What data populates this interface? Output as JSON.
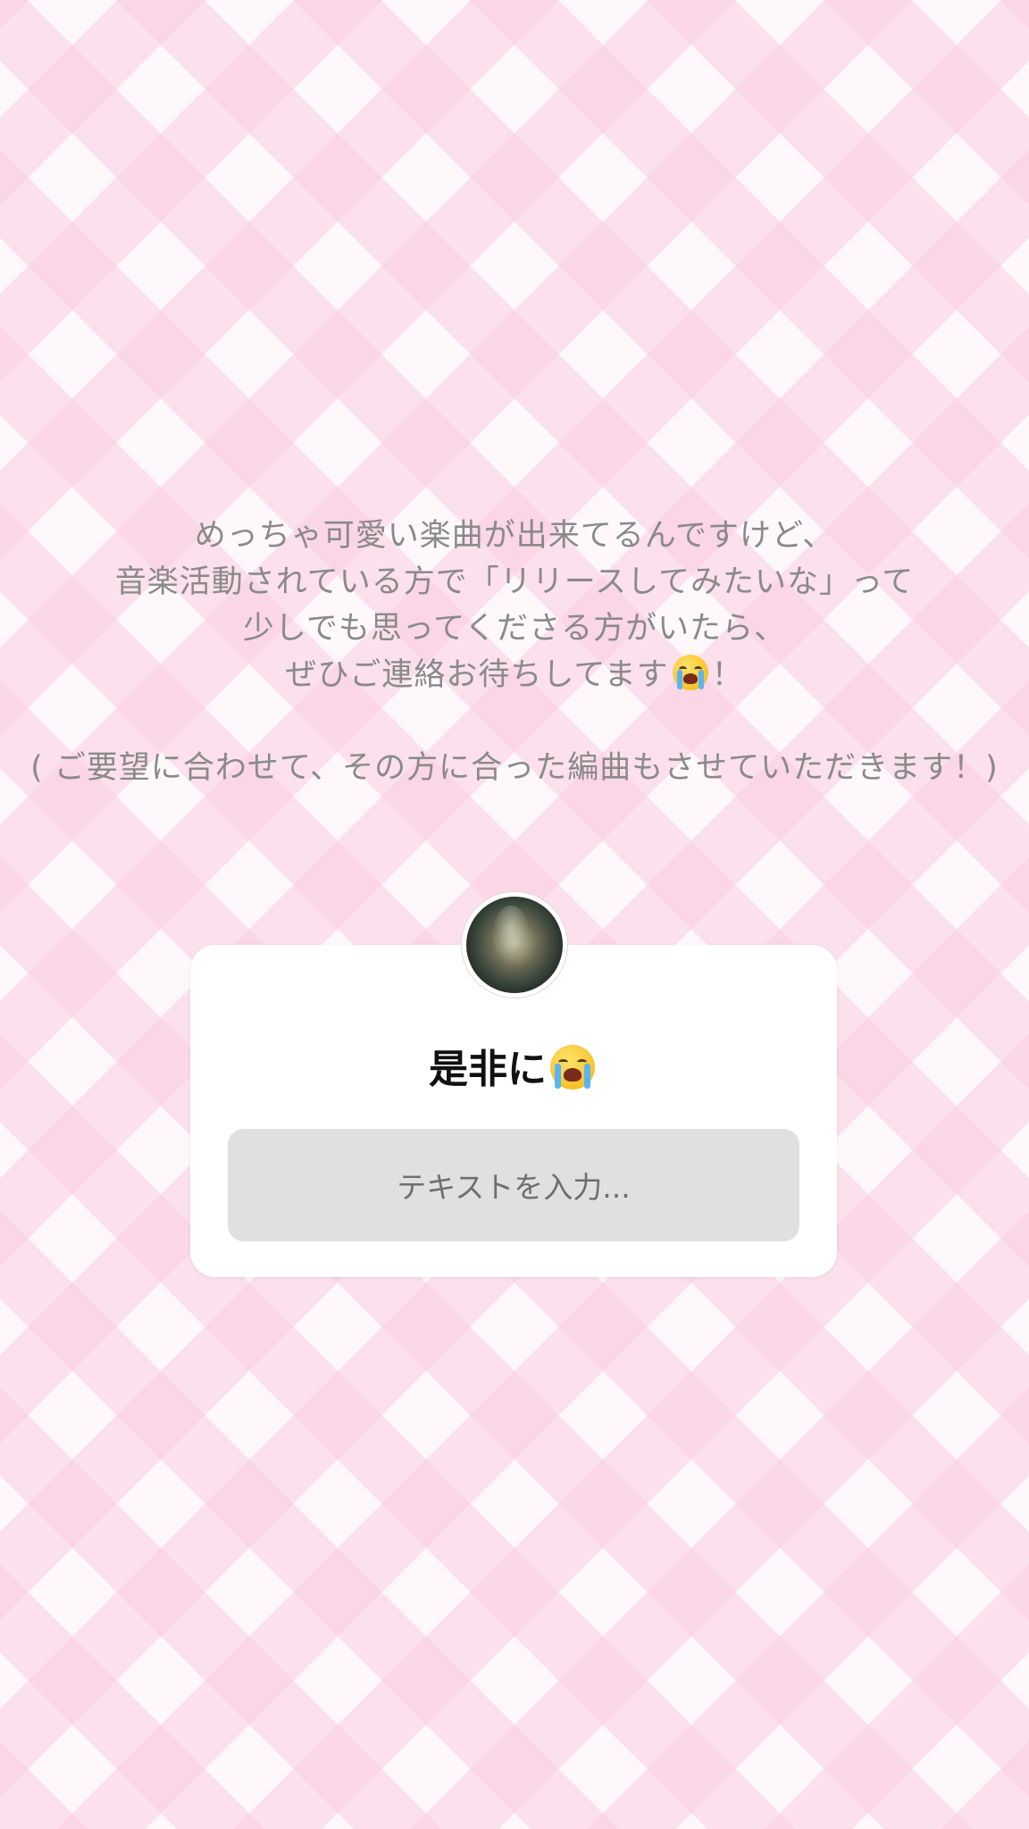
{
  "story": {
    "caption_lines": [
      "めっちゃ可愛い楽曲が出来てるんですけど、",
      "音楽活動されている方で「リリースしてみたいな」って",
      "少しでも思ってくださる方がいたら、",
      "ぜひご連絡お待ちしてます"
    ],
    "caption_line4_suffix": "！",
    "caption_note": "( ご要望に合わせて、その方に合った編曲もさせていただきます！)",
    "emoji": "loudly-crying-face"
  },
  "question_sticker": {
    "question": "是非に",
    "question_emoji": "loudly-crying-face",
    "input_placeholder": "テキストを入力..."
  }
}
